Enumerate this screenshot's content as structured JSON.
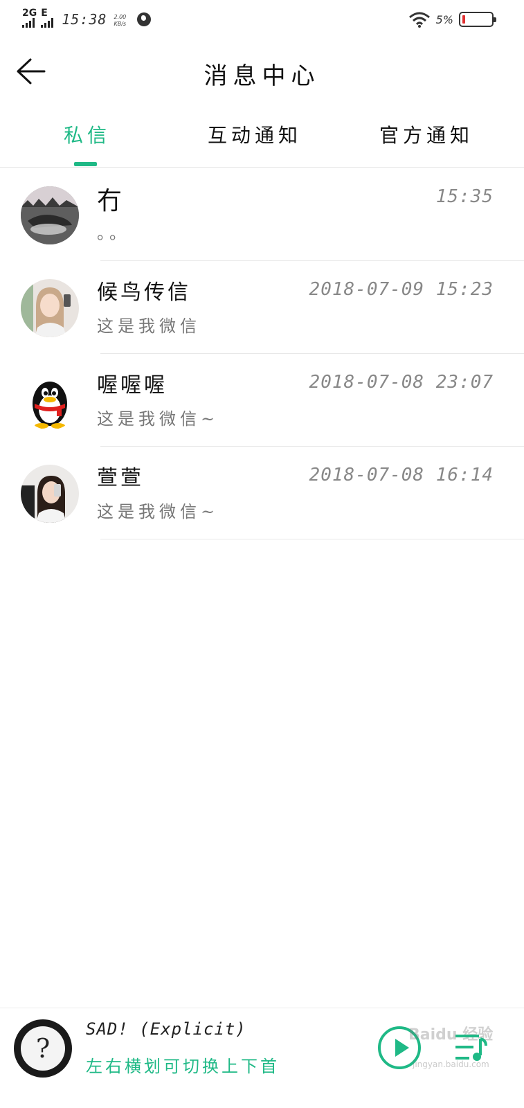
{
  "status_bar": {
    "network_2g": "2G",
    "network_e": "E",
    "time": "15:38",
    "speed_value": "2.00",
    "speed_unit": "KB/s",
    "battery_percent": "5%"
  },
  "header": {
    "title": "消息中心"
  },
  "tabs": [
    {
      "label": "私信",
      "active": true
    },
    {
      "label": "互动通知",
      "active": false
    },
    {
      "label": "官方通知",
      "active": false
    }
  ],
  "messages": [
    {
      "name": "冇",
      "preview": "。。",
      "time": "15:35"
    },
    {
      "name": "候鸟传信",
      "preview": "这是我微信",
      "time": "2018-07-09 15:23"
    },
    {
      "name": "喔喔喔",
      "preview": "这是我微信~",
      "time": "2018-07-08 23:07"
    },
    {
      "name": "萱萱",
      "preview": "这是我微信~",
      "time": "2018-07-08 16:14"
    }
  ],
  "player": {
    "album_glyph": "?",
    "song_title": "SAD! (Explicit)",
    "hint": "左右横划可切换上下首"
  },
  "watermark": {
    "text": "Baidu 经验",
    "sub": "jingyan.baidu.com"
  },
  "colors": {
    "accent": "#1fb986",
    "text": "#111111",
    "muted": "#777777"
  }
}
